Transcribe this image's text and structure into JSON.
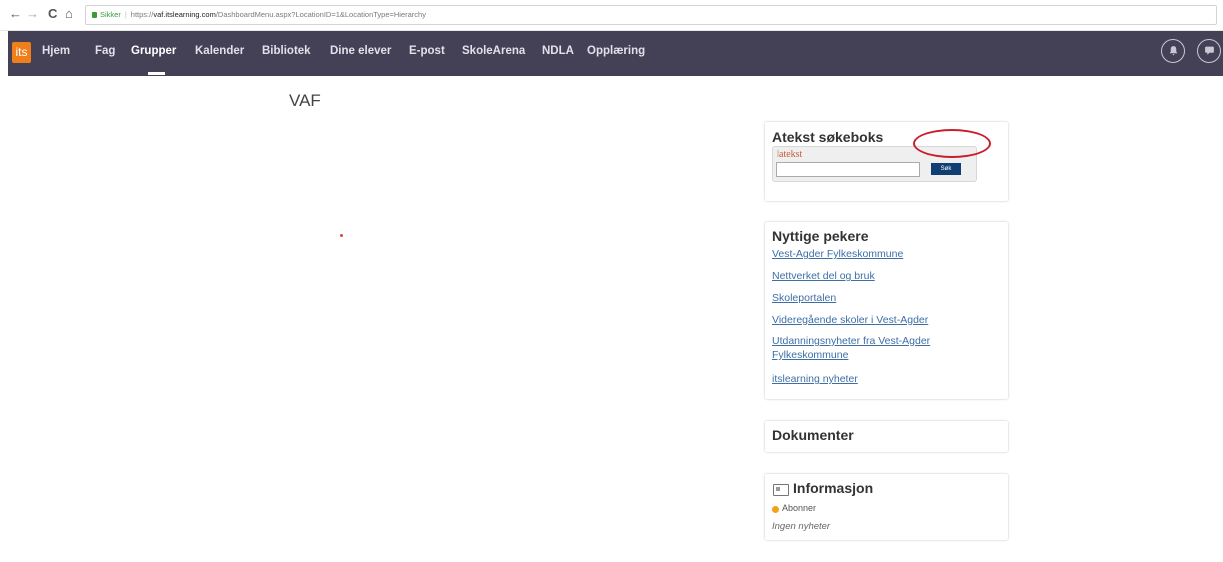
{
  "browser": {
    "back_icon": "←",
    "forward_icon": "→",
    "reload_icon": "C",
    "home_icon": "⌂",
    "secure_label": "Sikker",
    "url_scheme": "https://",
    "url_host": "vaf.itslearning.com",
    "url_path": "/DashboardMenu.aspx?LocationID=1&LocationType=Hierarchy"
  },
  "navbar": {
    "logo": "its",
    "items": [
      "Hjem",
      "Fag",
      "Grupper",
      "Kalender",
      "Bibliotek",
      "Dine elever",
      "E-post",
      "SkoleArena",
      "NDLA",
      "Opplæring"
    ],
    "active": "Grupper",
    "bell_icon": "bell-icon",
    "chat_icon": "chat-icon"
  },
  "page": {
    "title": "VAF"
  },
  "atekst": {
    "title": "Atekst søkeboks",
    "logo": "ǀatekst",
    "input_value": "",
    "button": "Søk"
  },
  "nyttige": {
    "title": "Nyttige pekere",
    "links": [
      "Vest-Agder Fylkeskommune",
      "Nettverket del og bruk",
      "Skoleportalen",
      "Videregående skoler i Vest-Agder",
      "Utdanningsnyheter fra Vest-Agder",
      "Fylkeskommune",
      "itslearning nyheter"
    ]
  },
  "dokumenter": {
    "title": "Dokumenter"
  },
  "informasjon": {
    "title": "Informasjon",
    "subscribe": "Abonner",
    "empty": "Ingen nyheter"
  },
  "colors": {
    "navbar": "#444156",
    "logo": "#ef7f1a",
    "link": "#3d6fa6",
    "highlight": "#c7202b",
    "sok_button": "#123f73"
  }
}
